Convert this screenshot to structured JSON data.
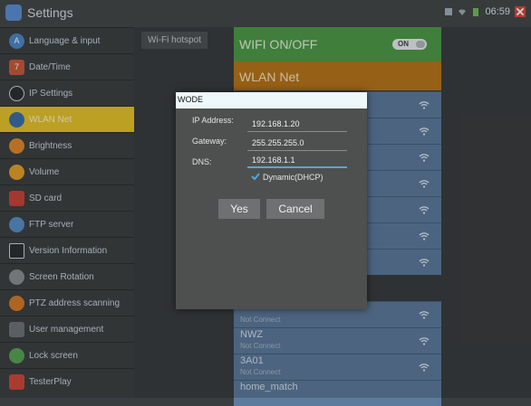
{
  "app": {
    "title": "Settings"
  },
  "status": {
    "time": "06:59"
  },
  "sidebar": {
    "items": [
      {
        "label": "Language & input",
        "icon": "language-icon"
      },
      {
        "label": "Date/Time",
        "icon": "calendar-icon"
      },
      {
        "label": "IP Settings",
        "icon": "globe-icon"
      },
      {
        "label": "WLAN Net",
        "icon": "wifi-icon"
      },
      {
        "label": "Brightness",
        "icon": "brightness-icon"
      },
      {
        "label": "Volume",
        "icon": "speaker-icon"
      },
      {
        "label": "SD card",
        "icon": "sd-card-icon"
      },
      {
        "label": "FTP server",
        "icon": "ftp-icon"
      },
      {
        "label": "Version Information",
        "icon": "monitor-icon"
      },
      {
        "label": "Screen Rotation",
        "icon": "rotation-icon"
      },
      {
        "label": "PTZ address scanning",
        "icon": "camera-icon"
      },
      {
        "label": "User management",
        "icon": "user-icon"
      },
      {
        "label": "Lock screen",
        "icon": "lock-icon"
      },
      {
        "label": "TesterPlay",
        "icon": "play-icon"
      }
    ]
  },
  "tabs": {
    "hotspot": "Wi-Fi hotspot"
  },
  "wifi": {
    "label": "WIFI ON/OFF",
    "toggle": "ON"
  },
  "wlan": {
    "label": "WLAN Net"
  },
  "networks": [
    {
      "name": "",
      "status": ""
    },
    {
      "name": "",
      "status": ""
    },
    {
      "name": "",
      "status": ""
    },
    {
      "name": "",
      "status": ""
    },
    {
      "name": "",
      "status": ""
    },
    {
      "name": "",
      "status": ""
    },
    {
      "name": "",
      "status": ""
    },
    {
      "name": "",
      "status": "Not Connect"
    },
    {
      "name": "NWZ",
      "status": "Not Connect"
    },
    {
      "name": "3A01",
      "status": "Not Connect"
    },
    {
      "name": "home_match",
      "status": ""
    }
  ],
  "dialog": {
    "title": "WODE",
    "ip_label": "IP Address:",
    "ip_value": "192.168.1.20",
    "gateway_label": "Gateway:",
    "gateway_value": "255.255.255.0",
    "dns_label": "DNS:",
    "dns_value": "192.168.1.1",
    "dhcp_label": "Dynamic(DHCP)",
    "dhcp_checked": true,
    "yes": "Yes",
    "cancel": "Cancel"
  },
  "colors": {
    "selected": "#e4c42c",
    "wifi_on": "#4f9a48",
    "wlan_header": "#b8761c",
    "network_row": "#5d7b9c",
    "accent": "#55a8d6"
  }
}
